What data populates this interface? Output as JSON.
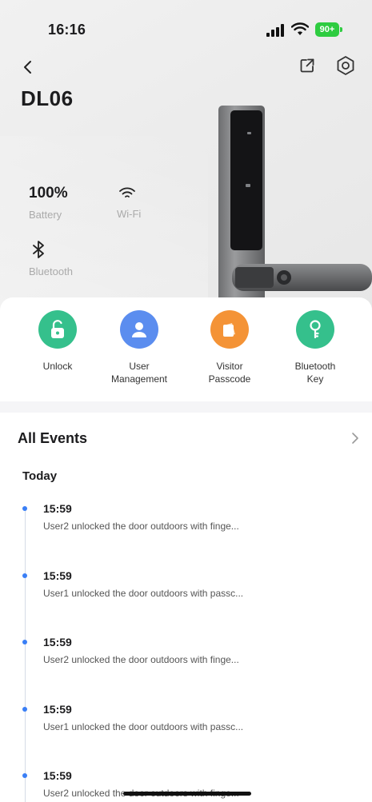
{
  "status_bar": {
    "time": "16:16",
    "battery": "90+",
    "battery_color": "#2ecc40"
  },
  "device": {
    "name": "DL06"
  },
  "stats": {
    "battery": {
      "value": "100%",
      "label": "Battery"
    },
    "wifi": {
      "label": "Wi-Fi",
      "icon": "wifi-icon"
    },
    "bluetooth": {
      "label": "Bluetooth",
      "icon": "bluetooth-icon"
    }
  },
  "actions": [
    {
      "label": "Unlock",
      "icon": "unlock-icon",
      "color": "#35c08c"
    },
    {
      "label": "User\nManagement",
      "icon": "user-icon",
      "color": "#5b8def"
    },
    {
      "label": "Visitor\nPasscode",
      "icon": "passcode-icon",
      "color": "#f49336"
    },
    {
      "label": "Bluetooth\nKey",
      "icon": "key-icon",
      "color": "#35c08c"
    }
  ],
  "events": {
    "title": "All Events",
    "day": "Today",
    "items": [
      {
        "time": "15:59",
        "description": "User2 unlocked the door outdoors with finge..."
      },
      {
        "time": "15:59",
        "description": "User1 unlocked the door outdoors with passc..."
      },
      {
        "time": "15:59",
        "description": "User2 unlocked the door outdoors with finge..."
      },
      {
        "time": "15:59",
        "description": "User1 unlocked the door outdoors with passc..."
      },
      {
        "time": "15:59",
        "description": "User2 unlocked the door outdoors with finge..."
      }
    ]
  },
  "colors": {
    "accent": "#3a7ff6",
    "timeline": "#d6dbe6"
  }
}
